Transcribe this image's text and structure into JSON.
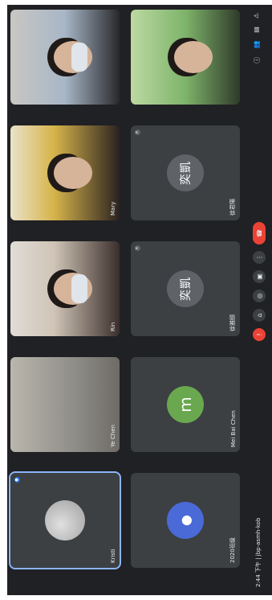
{
  "meeting": {
    "time": "2:44 下午",
    "separator": "|",
    "code": "jbp-asmh-kob"
  },
  "participants": [
    {
      "name": "Kristi",
      "type": "image-avatar",
      "active": true
    },
    {
      "name": "Ye Chen",
      "type": "video"
    },
    {
      "name": "Rin",
      "type": "video"
    },
    {
      "name": "Mary",
      "type": "video"
    },
    {
      "name": "",
      "type": "video"
    },
    {
      "name": "2020班级",
      "type": "avatar",
      "avatar_color": "#4a6ad8",
      "initial": "●"
    },
    {
      "name": "Mei Bai Chen",
      "type": "avatar",
      "avatar_color": "#6aa84f",
      "initial": "m"
    },
    {
      "name": "徐雅颐",
      "type": "avatar",
      "avatar_color": "#5f6368",
      "initial": "奕凱"
    },
    {
      "name": "徐君陽",
      "type": "avatar",
      "avatar_color": "#5f6368",
      "initial": "奕凱"
    },
    {
      "name": "",
      "type": "video"
    }
  ],
  "controls": {
    "mic_icon": "mic-off-icon",
    "camera_icon": "camera-icon",
    "captions_icon": "captions-icon",
    "present_icon": "present-icon",
    "more_icon": "more-icon",
    "end_icon": "end-call-icon"
  },
  "colors": {
    "background": "#202124",
    "tile": "#3c4043",
    "end_call": "#ea4335",
    "active_outline": "#8ab4f8"
  }
}
